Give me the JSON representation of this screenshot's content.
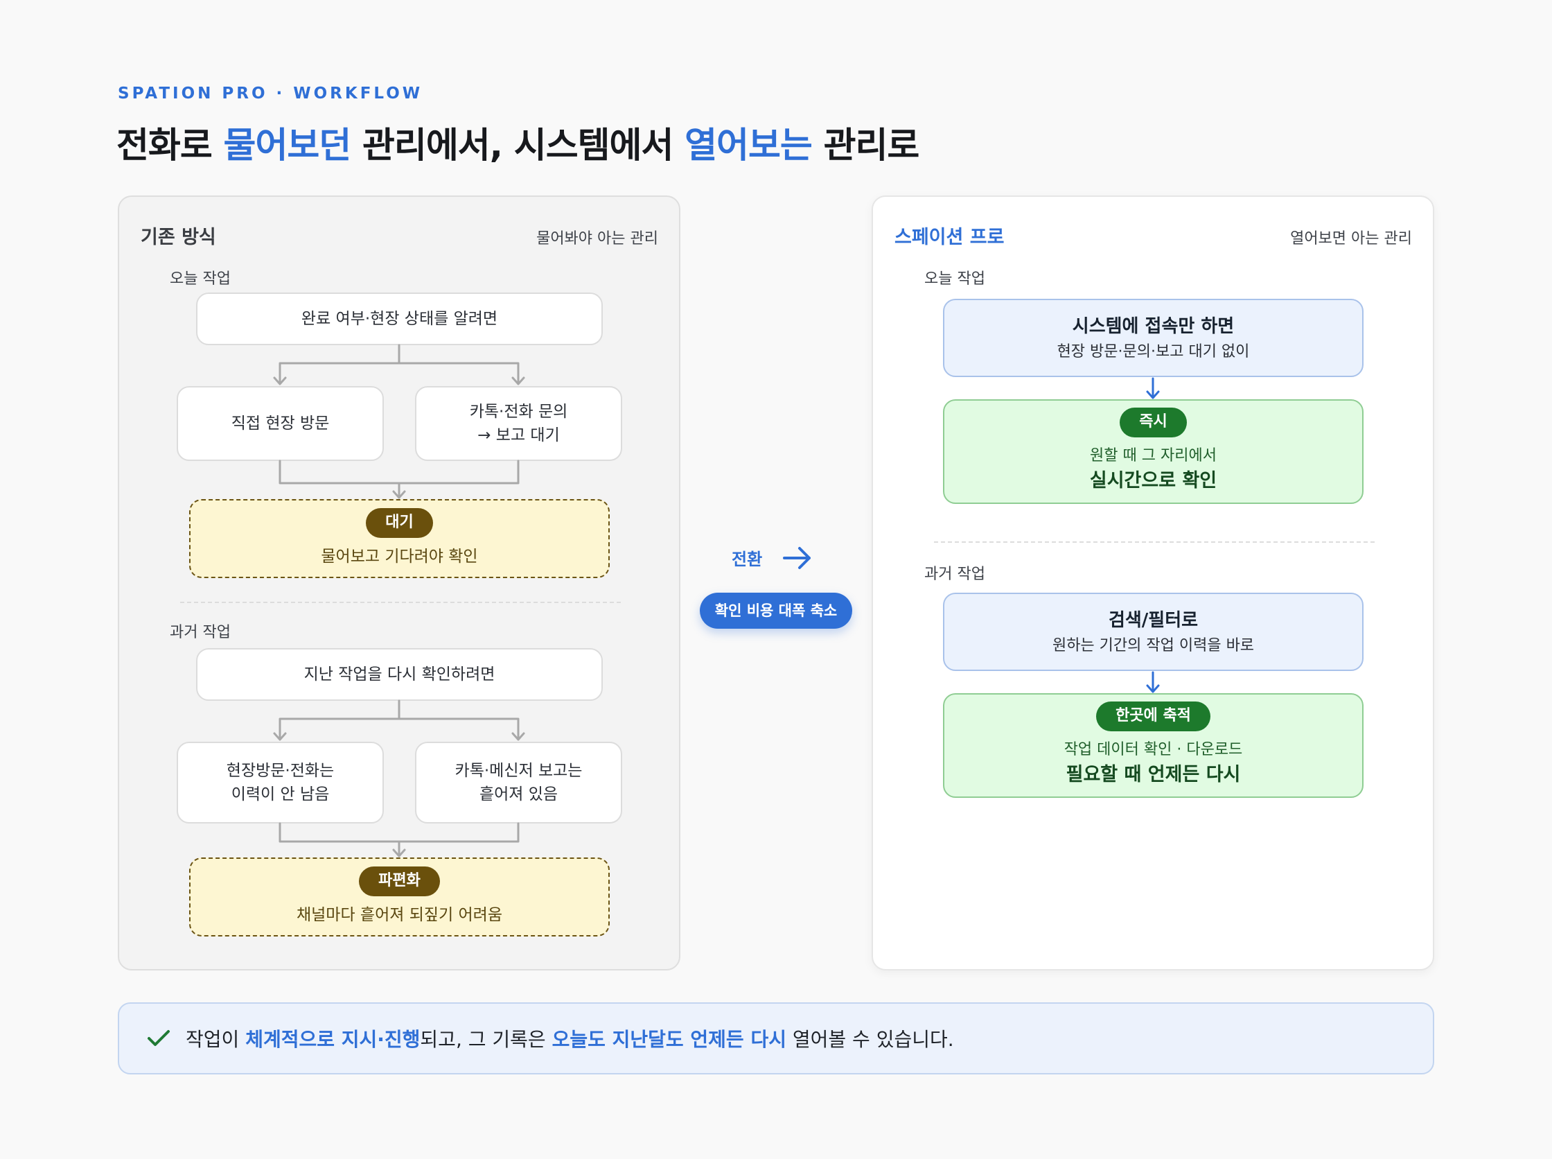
{
  "header": {
    "eyebrow": "SPATION PRO · WORKFLOW",
    "title_parts": [
      "전화로 ",
      "물어보던",
      " 관리에서, 시스템에서 ",
      "열어보는",
      " 관리로"
    ]
  },
  "left_panel": {
    "title": "기존 방식",
    "subtitle": "물어봐야 아는 관리",
    "today": {
      "label": "오늘 작업",
      "trigger": "완료 여부·현장 상태를 알려면",
      "option_a": "직접 현장 방문",
      "option_b_line1": "카톡·전화 문의",
      "option_b_line2": "→ 보고 대기",
      "result_badge": "대기",
      "result_text": "물어보고 기다려야 확인"
    },
    "past": {
      "label": "과거 작업",
      "trigger": "지난 작업을 다시 확인하려면",
      "option_a_line1": "현장방문·전화는",
      "option_a_line2": "이력이 안 남음",
      "option_b_line1": "카톡·메신저 보고는",
      "option_b_line2": "흩어져 있음",
      "result_badge": "파편화",
      "result_text": "채널마다 흩어져 되짚기 어려움"
    }
  },
  "middle": {
    "label": "전환",
    "badge": "확인 비용 대폭 축소"
  },
  "right_panel": {
    "title": "스페이션 프로",
    "subtitle": "열어보면 아는 관리",
    "today": {
      "label": "오늘 작업",
      "box_title": "시스템에 접속만 하면",
      "box_sub": "현장 방문·문의·보고 대기 없이",
      "result_badge": "즉시",
      "result_sub": "원할 때 그 자리에서",
      "result_strong": "실시간으로 확인"
    },
    "past": {
      "label": "과거 작업",
      "box_title": "검색/필터로",
      "box_sub": "원하는 기간의 작업 이력을 바로",
      "result_badge": "한곳에 축적",
      "result_sub": "작업 데이터 확인 · 다운로드",
      "result_strong": "필요할 때 언제든 다시"
    }
  },
  "footer": {
    "parts": [
      "작업이 ",
      "체계적으로 지시·진행",
      "되고, 그 기록은 ",
      "오늘도 지난달도 언제든 다시",
      " 열어볼 수 있습니다."
    ]
  },
  "colors": {
    "accent": "#2f6fd6",
    "brown_badge": "#6a500c",
    "green_badge": "#1d7a2c",
    "connector_gray": "#a8a8a8",
    "connector_blue": "#2f6fd6"
  },
  "icons": [
    "check-icon",
    "arrow-right-icon",
    "arrow-down-icon"
  ]
}
